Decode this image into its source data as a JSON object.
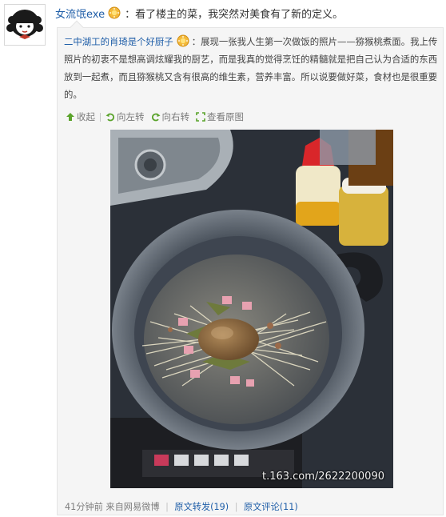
{
  "post": {
    "username": "女流氓exe",
    "badge_icon": "gold-sun-badge-icon",
    "text": "：看了楼主的菜，我突然对美食有了新的定义。"
  },
  "quote": {
    "username": "二中湖工的肖琦是个好厨子",
    "badge_icon": "gold-sun-badge-icon",
    "text": "：展现一张我人生第一次做饭的照片——猕猴桃煮面。我上传照片的初衷不是想高调炫耀我的厨艺，而是我真的觉得烹饪的精髓就是把自己认为合适的东西放到一起煮，而且猕猴桃又含有很高的维生素，营养丰富。所以说要做好菜，食材也是很重要的。"
  },
  "toolbar": {
    "collapse": "收起",
    "rotate_left": "向左转",
    "rotate_right": "向右转",
    "view_original": "查看原图"
  },
  "image": {
    "watermark": "t.163.com/2622200090"
  },
  "footer": {
    "time": "41分钟前",
    "source": "来自网易微博",
    "repost_label": "原文转发(19)",
    "comment_label": "原文评论(11)"
  },
  "colors": {
    "link": "#1f5ea8",
    "quote_background": "#f5f5f5",
    "toolbar_icon": "#5aa32b"
  }
}
